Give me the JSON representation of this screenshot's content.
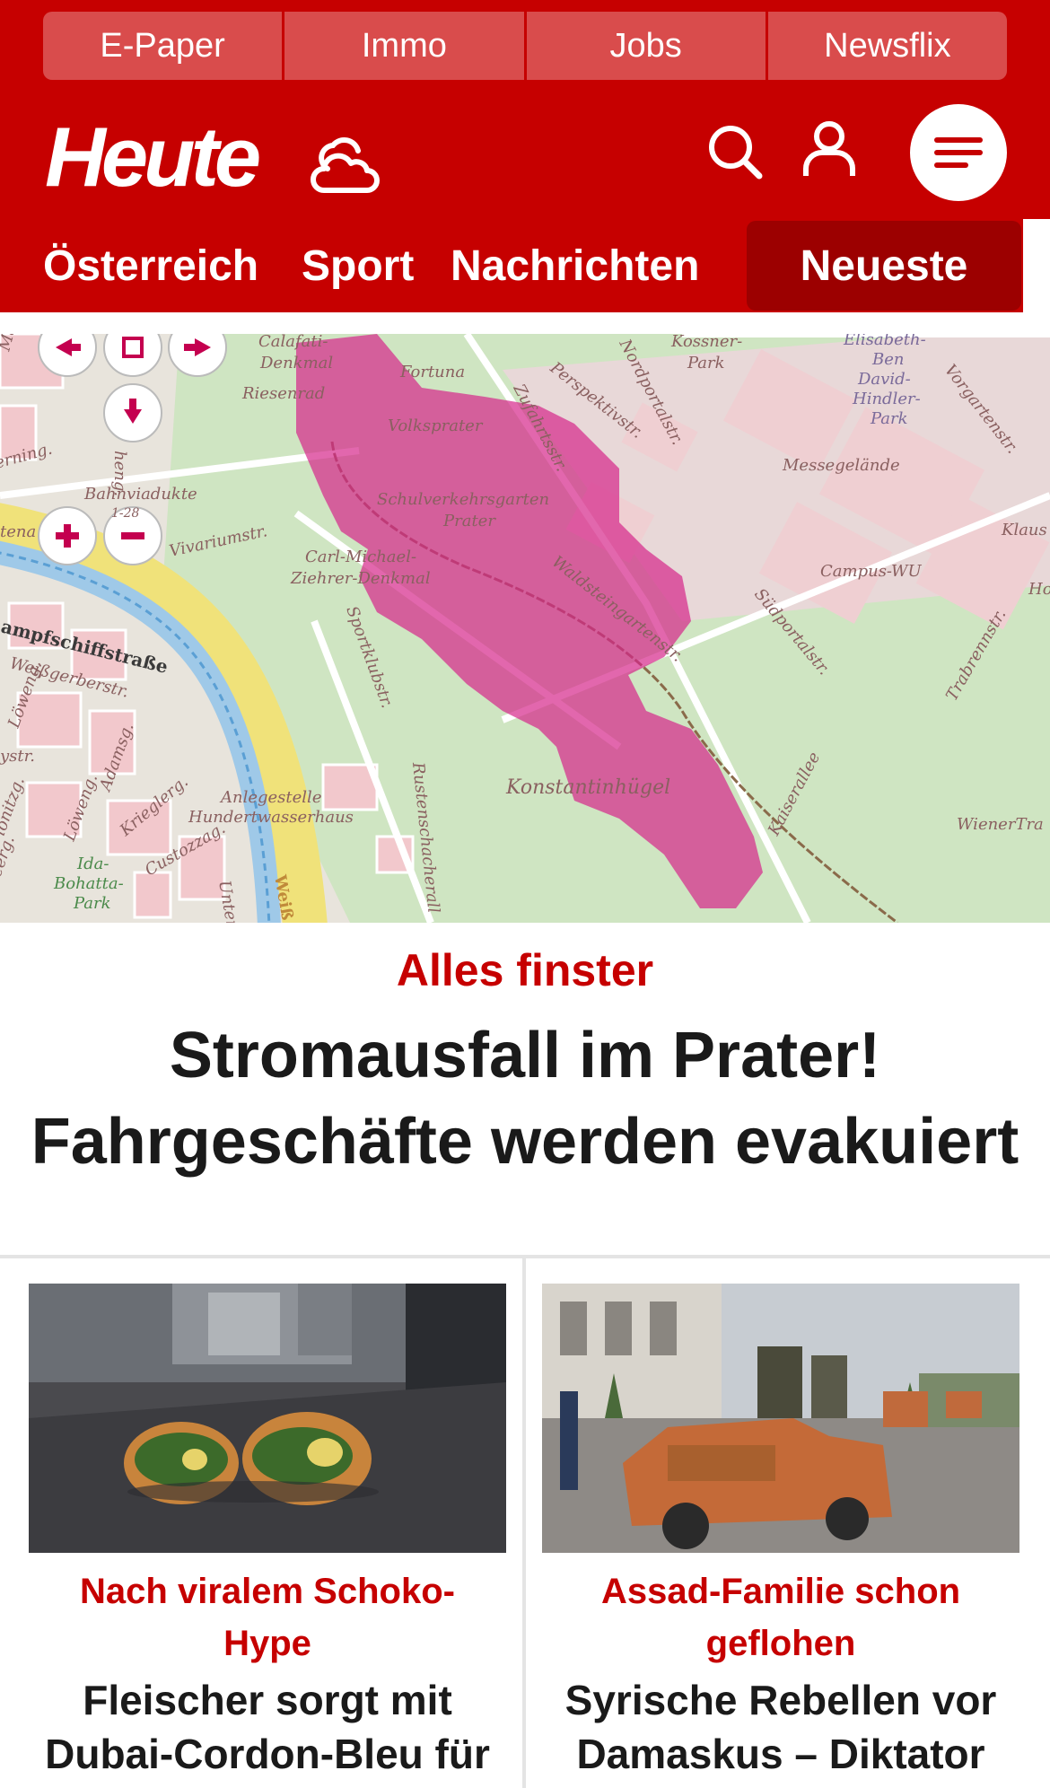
{
  "top_links": [
    "E-Paper",
    "Immo",
    "Jobs",
    "Newsflix"
  ],
  "header": {
    "logo": "Heute"
  },
  "nav": {
    "items": [
      "Österreich",
      "Sport",
      "Nachrichten"
    ],
    "active": "Neueste"
  },
  "colors": {
    "brand": "#c60000",
    "brand_dark": "#9c0000",
    "toplink_bg": "#d94c4c",
    "highlight": "#d6278a"
  },
  "map": {
    "labels": {
      "calafati": "Calafati-",
      "denkmal": "Denkmal",
      "riesenrad": "Riesenrad",
      "fortuna": "Fortuna",
      "volksprater": "Volksprater",
      "schulverkehrsgarten": "Schulverkehrsgarten",
      "prater": "Prater",
      "zufahrtsstr": "Zufahrtsstr.",
      "perspektivstr": "Perspektivstr.",
      "nordportalstr": "Nordportalstr.",
      "kossner": "Kossner-",
      "park": "Park",
      "elisabeth": "Elisabeth-",
      "ben": "Ben",
      "david": "David-",
      "hindler": "Hindler-",
      "park2": "Park",
      "vorgartenstr": "Vorgartenstr.",
      "messegelaende": "Messegelände",
      "klaus": "Klaus",
      "campus": "Campus-WU",
      "ho": "Ho",
      "suedportalstr": "Südportalstr.",
      "trabrennstr": "Trabrennstr.",
      "waldsteingartenstr": "Waldsteingartenstr.",
      "carl": "Carl-Michael-",
      "ziehrer": "Ziehrer-Denkmal",
      "vivariumstr": "Vivariumstr.",
      "bahnviadukte": "Bahnviadukte",
      "bahnnr": "1-28",
      "sportklubstr": "Sportklubstr.",
      "konstantinhuegel": "Konstantinhügel",
      "kaiserallee": "Kaiserallee",
      "wienertra": "WienerTra",
      "rustenschacherall": "Rustenschacherall",
      "anlegestelle": "Anlegestelle",
      "hundertwasserhaus": "Hundertwasserhaus",
      "dampfschiffstrasse": "ampfschiffstraße",
      "weissgerberstr": "Weißgerberstr.",
      "loewengasse": "Löweng.",
      "loewengasse2": "Löweng.",
      "adamsg": "Adamsg.",
      "krieglerg": "Krieglerg.",
      "custozzag": "Custozzag.",
      "ida": "Ida-",
      "bohatta": "Bohatta-",
      "park3": "Park",
      "unter": "Unter",
      "weiss": "Weiß",
      "mayerg": "Mayerg.",
      "erning": "erning.",
      "tena": "tena",
      "ystr": "ystr.",
      "eerg": "eerg.",
      "lonitz": "lonitzg.",
      "heng": "heng."
    }
  },
  "hero": {
    "kicker": "Alles finster",
    "title_line1": "Stromausfall im Prater!",
    "title_line2": "Fahrgeschäfte werden evakuiert"
  },
  "cards": [
    {
      "kicker_line1": "Nach viralem Schoko-",
      "kicker_line2": "Hype",
      "title_line1": "Fleischer sorgt mit",
      "title_line2": "Dubai-Cordon-Bleu für"
    },
    {
      "kicker_line1": "Assad-Familie schon",
      "kicker_line2": "geflohen",
      "title_line1": "Syrische Rebellen vor",
      "title_line2": "Damaskus – Diktator"
    }
  ]
}
